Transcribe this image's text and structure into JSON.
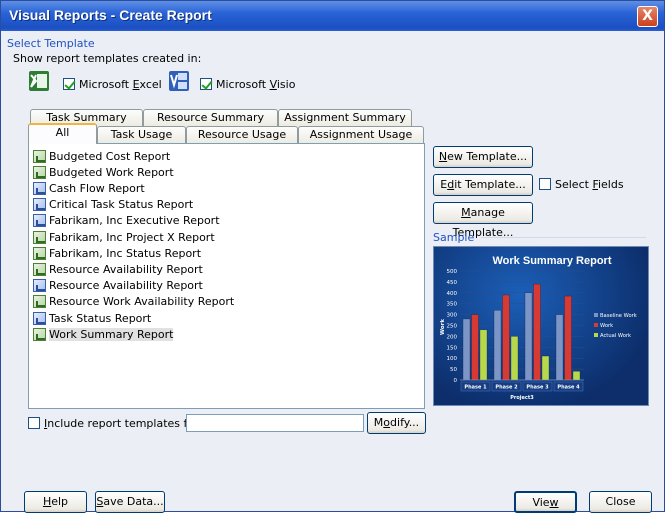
{
  "window": {
    "title": "Visual Reports - Create Report",
    "close_glyph": "X"
  },
  "select_template": {
    "group_label": "Select Template",
    "show_label": "Show report templates created in:",
    "excel": {
      "icon": "excel-icon",
      "label_pre": "Microsoft ",
      "label_u": "E",
      "label_post": "xcel",
      "checked": true
    },
    "visio": {
      "icon": "visio-icon",
      "label_pre": "Microsoft ",
      "label_u": "V",
      "label_post": "isio",
      "checked": true
    }
  },
  "tabs": {
    "row1": [
      "Task Summary",
      "Resource Summary",
      "Assignment Summary"
    ],
    "row2": [
      "All",
      "Task Usage",
      "Resource Usage",
      "Assignment Usage"
    ],
    "active": "All"
  },
  "reports": [
    {
      "name": "Budgeted Cost Report",
      "type": "excel"
    },
    {
      "name": "Budgeted Work Report",
      "type": "excel"
    },
    {
      "name": "Cash Flow Report",
      "type": "visio"
    },
    {
      "name": "Critical Task Status Report",
      "type": "visio"
    },
    {
      "name": "Fabrikam, Inc Executive Report",
      "type": "visio"
    },
    {
      "name": "Fabrikam, Inc Project X Report",
      "type": "excel"
    },
    {
      "name": "Fabrikam, Inc Status Report",
      "type": "excel"
    },
    {
      "name": "Resource Availability Report",
      "type": "excel"
    },
    {
      "name": "Resource Availability Report",
      "type": "visio"
    },
    {
      "name": "Resource Work Availability Report",
      "type": "excel"
    },
    {
      "name": "Task Status Report",
      "type": "visio"
    },
    {
      "name": "Work Summary Report",
      "type": "excel",
      "selected": true
    }
  ],
  "buttons": {
    "new_template": {
      "u": "N",
      "rest": "ew Template..."
    },
    "edit_template": {
      "pre": "E",
      "u": "d",
      "rest": "it Template..."
    },
    "manage_template": {
      "u": "M",
      "rest": "anage Template..."
    },
    "modify": {
      "pre": "M",
      "u": "o",
      "rest": "dify..."
    },
    "help": {
      "u": "H",
      "rest": "elp"
    },
    "save_data": {
      "u": "S",
      "rest": "ave Data..."
    },
    "view": {
      "pre": "Vie",
      "u": "w",
      "rest": ""
    },
    "close": "Close"
  },
  "select_fields": {
    "pre": "Select ",
    "u": "F",
    "rest": "ields",
    "checked": false
  },
  "include": {
    "u": "I",
    "rest": "nclude report templates from:",
    "checked": false,
    "value": ""
  },
  "sample": {
    "group_label": "Sample",
    "chart_data": {
      "type": "bar",
      "title": "Work Summary Report",
      "xlabel": "Project3",
      "ylabel": "Work",
      "categories": [
        "Phase 1",
        "Phase 2",
        "Phase 3",
        "Phase 4"
      ],
      "ylim": [
        0,
        500
      ],
      "yticks": [
        "500",
        "450",
        "400",
        "350",
        "300",
        "250",
        "200",
        "150",
        "100",
        "50",
        "0"
      ],
      "series": [
        {
          "name": "Baseline Work",
          "color": "#7a95c6",
          "values": [
            280,
            320,
            400,
            300
          ]
        },
        {
          "name": "Work",
          "color": "#d73a32",
          "values": [
            300,
            390,
            440,
            385
          ]
        },
        {
          "name": "Actual Work",
          "color": "#b6d84a",
          "values": [
            230,
            200,
            110,
            40
          ]
        }
      ],
      "legend": "right"
    }
  }
}
